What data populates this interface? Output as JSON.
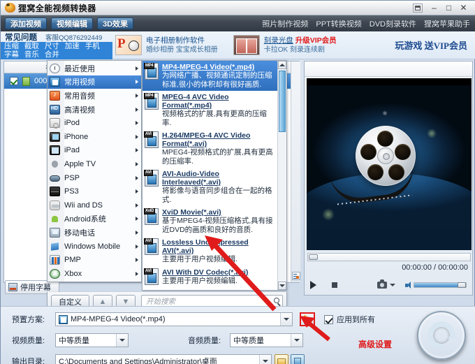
{
  "window": {
    "title": "狸窝全能视频转换器",
    "app_icon": "app-logo-icon",
    "controls": {
      "skin": "skin-icon",
      "minimize": "–",
      "maximize": "□",
      "close": "✕"
    }
  },
  "toolbar": {
    "buttons": [
      {
        "label": "添加视频",
        "name": "add-video-button"
      },
      {
        "label": "视频编辑",
        "name": "video-edit-button"
      },
      {
        "label": "3D效果",
        "name": "3d-effect-button"
      }
    ],
    "links": [
      "照片制作视频",
      "PPT转换视频",
      "DVD刻录软件",
      "狸窝苹果助手"
    ]
  },
  "promo": {
    "faq_title": "常见问题",
    "faq_qq": "客服QQ876292449",
    "faq_tags_line1": [
      "压缩",
      "截取",
      "尺寸",
      "加速",
      "手机"
    ],
    "faq_tags_line2": [
      "字幕",
      "音乐",
      "合并"
    ],
    "cell_ppt": {
      "line1": "电子相册制作软件",
      "line2": "婚纱相册  宝宝成长相册"
    },
    "cell_dvd": {
      "line1": "刻录光盘",
      "vip": "升级VIP会员",
      "line2": "卡拉OK  刻录连续剧"
    },
    "game": "玩游戏  送VIP会员"
  },
  "filelist": {
    "column_name": "名称",
    "rows": [
      {
        "name": "000",
        "checked": true
      }
    ],
    "side_button": "list-options-icon",
    "subtitle_button": "停用字幕"
  },
  "category_menu": {
    "items": [
      {
        "label": "最近使用",
        "icon": "clock-icon",
        "icon_class": "ic-clock",
        "selected": false
      },
      {
        "label": "常用视频",
        "icon": "video-icon",
        "icon_class": "ic-video",
        "selected": true
      },
      {
        "label": "常用音频",
        "icon": "audio-icon",
        "icon_class": "ic-audio",
        "selected": false
      },
      {
        "label": "高清视频",
        "icon": "hd-icon",
        "icon_class": "ic-hd",
        "selected": false
      },
      {
        "label": "iPod",
        "icon": "ipod-icon",
        "icon_class": "ic-ipod",
        "selected": false
      },
      {
        "label": "iPhone",
        "icon": "iphone-icon",
        "icon_class": "ic-iphone",
        "selected": false
      },
      {
        "label": "iPad",
        "icon": "ipad-icon",
        "icon_class": "ic-ipad",
        "selected": false
      },
      {
        "label": "Apple TV",
        "icon": "apple-icon",
        "icon_class": "ic-apple",
        "selected": false
      },
      {
        "label": "PSP",
        "icon": "psp-icon",
        "icon_class": "ic-psp",
        "selected": false
      },
      {
        "label": "PS3",
        "icon": "ps3-icon",
        "icon_class": "ic-ps3",
        "selected": false
      },
      {
        "label": "Wii and DS",
        "icon": "wii-icon",
        "icon_class": "ic-wii",
        "selected": false
      },
      {
        "label": "Android系统",
        "icon": "android-icon",
        "icon_class": "ic-android",
        "selected": false
      },
      {
        "label": "移动电话",
        "icon": "phone-icon",
        "icon_class": "ic-phone",
        "selected": false
      },
      {
        "label": "Windows Mobile",
        "icon": "windows-icon",
        "icon_class": "ic-winmo",
        "selected": false
      },
      {
        "label": "PMP",
        "icon": "pmp-icon",
        "icon_class": "ic-pmp",
        "selected": false
      },
      {
        "label": "Xbox",
        "icon": "xbox-icon",
        "icon_class": "ic-xbox",
        "selected": false
      }
    ]
  },
  "format_list": {
    "items": [
      {
        "tag": "MP4",
        "title": "MP4-MPEG-4 Video(*.mp4)",
        "desc": "为网络广播、视频通讯定制的压缩标准,很小的体积却有很好画质.",
        "selected": true
      },
      {
        "tag": "MP4",
        "title": "MPEG-4 AVC Video Format(*.mp4)",
        "desc": "视频格式的扩展,具有更高的压缩率.",
        "selected": false
      },
      {
        "tag": "AVI",
        "title": "H.264/MPEG-4 AVC Video Format(*.avi)",
        "desc": "MPEG4-视频格式的扩展,具有更高的压缩率.",
        "selected": false
      },
      {
        "tag": "AVI",
        "title": "AVI-Audio-Video Interleaved(*.avi)",
        "desc": "将影像与语音同步组合在一起的格式.",
        "selected": false
      },
      {
        "tag": "XviD",
        "title": "XviD Movie(*.avi)",
        "desc": "基于MPEG4-视频压缩格式,具有接近DVD的画质和良好的音质.",
        "selected": false
      },
      {
        "tag": "AVI",
        "title": "Lossless Uncompressed AVI(*.avi)",
        "desc": "主要用于用户视频编辑.",
        "selected": false
      },
      {
        "tag": "AVI",
        "title": "AVI With DV Codec(*.avi)",
        "desc": "主要用于用户视频编辑.",
        "selected": false
      }
    ],
    "custom_button": "自定义",
    "up_button": "▲",
    "down_button": "▼",
    "search_placeholder": "开始搜索"
  },
  "preview": {
    "time": "00:00:00 / 00:00:00",
    "play": "play-icon",
    "stop": "stop-icon",
    "snapshot": "camera-icon",
    "volume": "speaker-icon"
  },
  "settings": {
    "preset_label": "预置方案:",
    "preset_value": "MP4-MPEG-4 Video(*.mp4)",
    "advanced_button": "wrench-icon",
    "apply_all_label": "应用到所有",
    "apply_all_checked": true,
    "video_quality_label": "视频质量:",
    "video_quality_value": "中等质量",
    "audio_quality_label": "音频质量:",
    "audio_quality_value": "中等质量",
    "output_label": "输出目录:",
    "output_value": "C:\\Documents and Settings\\Administrator\\桌面",
    "browse_button": "folder-icon",
    "open_button": "open-folder-icon",
    "convert_button": "convert-icon"
  },
  "annotations": {
    "advanced_label": "高级设置",
    "accent_red": "#e01b1b"
  }
}
